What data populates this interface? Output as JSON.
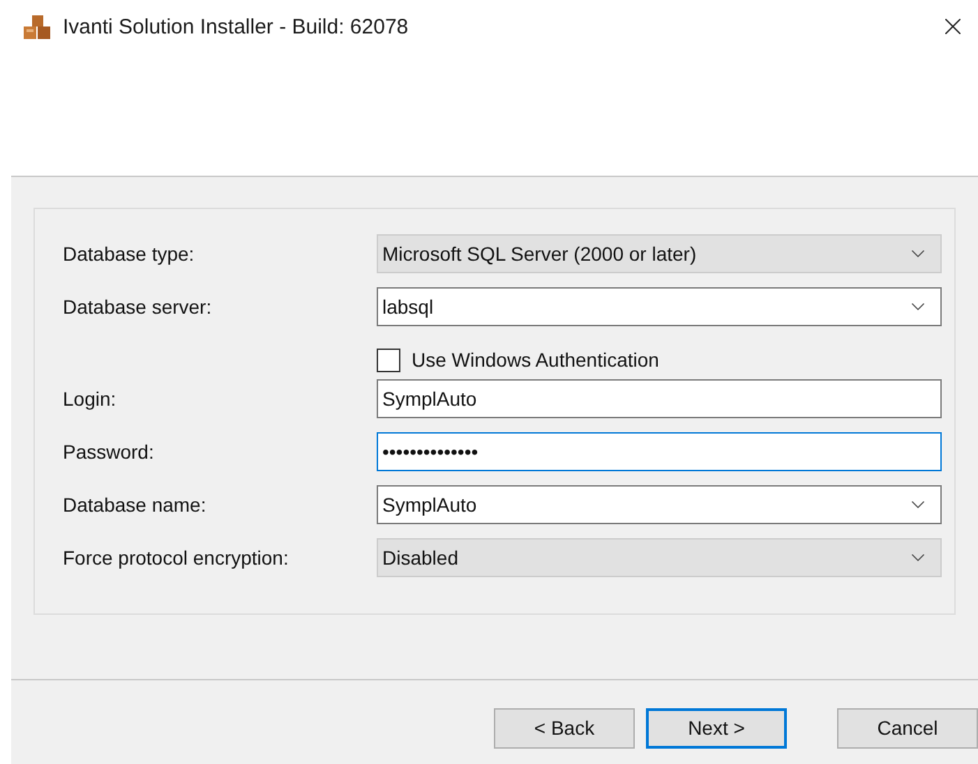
{
  "window": {
    "title": "Ivanti Solution Installer - Build: 62078"
  },
  "fields": [
    {
      "kind": "select",
      "label": "Database type:",
      "value": "Microsoft SQL Server (2000 or later)",
      "focused": false
    },
    {
      "kind": "combo",
      "label": "Database server:",
      "value": "labsql",
      "focused": false
    },
    {
      "kind": "checkbox",
      "label": "Use Windows Authentication",
      "checked": false
    },
    {
      "kind": "text",
      "label": "Login:",
      "value": "SymplAuto",
      "focused": false
    },
    {
      "kind": "text",
      "label": "Password:",
      "value": "••••••••••••••",
      "focused": true
    },
    {
      "kind": "combo",
      "label": "Database name:",
      "value": "SymplAuto",
      "focused": false
    },
    {
      "kind": "select",
      "label": "Force protocol encryption:",
      "value": "Disabled",
      "focused": false
    }
  ],
  "buttons": [
    {
      "label": "< Back",
      "default": false
    },
    {
      "label": "Next >",
      "default": true
    },
    {
      "label": "Cancel",
      "default": false
    }
  ]
}
